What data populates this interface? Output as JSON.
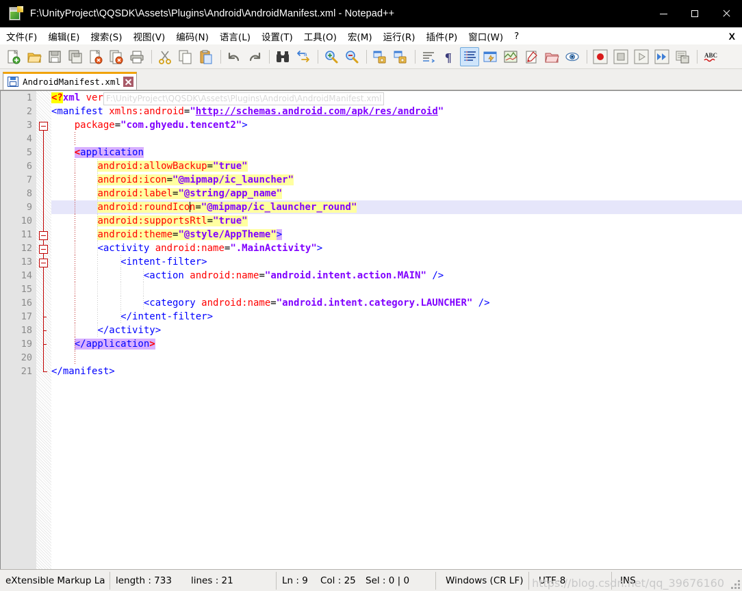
{
  "window": {
    "title": "F:\\UnityProject\\QQSDK\\Assets\\Plugins\\Android\\AndroidManifest.xml - Notepad++",
    "app_icon": "notepad-plus-plus-icon",
    "controls": {
      "minimize": "minimize-icon",
      "maximize": "maximize-icon",
      "close": "close-icon"
    }
  },
  "menubar": {
    "items": [
      {
        "label": "文件(F)",
        "name": "file"
      },
      {
        "label": "编辑(E)",
        "name": "edit"
      },
      {
        "label": "搜索(S)",
        "name": "search"
      },
      {
        "label": "视图(V)",
        "name": "view"
      },
      {
        "label": "编码(N)",
        "name": "encoding"
      },
      {
        "label": "语言(L)",
        "name": "language"
      },
      {
        "label": "设置(T)",
        "name": "settings"
      },
      {
        "label": "工具(O)",
        "name": "tools"
      },
      {
        "label": "宏(M)",
        "name": "macro"
      },
      {
        "label": "运行(R)",
        "name": "run"
      },
      {
        "label": "插件(P)",
        "name": "plugins"
      },
      {
        "label": "窗口(W)",
        "name": "window"
      },
      {
        "label": "?",
        "name": "help"
      }
    ],
    "close_doc_label": "X"
  },
  "toolbar": {
    "groups": [
      [
        {
          "icon": "new-file-icon",
          "label": "新建"
        },
        {
          "icon": "open-folder-icon",
          "label": "打开"
        },
        {
          "icon": "save-icon",
          "label": "保存"
        },
        {
          "icon": "save-all-icon",
          "label": "全部保存"
        },
        {
          "icon": "close-file-icon",
          "label": "关闭"
        },
        {
          "icon": "close-all-files-icon",
          "label": "全部关闭"
        },
        {
          "icon": "print-icon",
          "label": "打印"
        }
      ],
      [
        {
          "icon": "cut-scissors-icon",
          "label": "剪切"
        },
        {
          "icon": "copy-icon",
          "label": "复制"
        },
        {
          "icon": "paste-icon",
          "label": "粘贴"
        }
      ],
      [
        {
          "icon": "undo-arrow-icon",
          "label": "撤销"
        },
        {
          "icon": "redo-arrow-icon",
          "label": "恢复"
        }
      ],
      [
        {
          "icon": "find-binoculars-icon",
          "label": "查找"
        },
        {
          "icon": "replace-icon",
          "label": "替换"
        }
      ],
      [
        {
          "icon": "zoom-in-icon",
          "label": "放大"
        },
        {
          "icon": "zoom-out-icon",
          "label": "缩小"
        }
      ],
      [
        {
          "icon": "sync-vertical-scroll-icon",
          "label": "同步垂直滚动"
        },
        {
          "icon": "sync-horizontal-scroll-icon",
          "label": "同步水平滚动"
        }
      ],
      [
        {
          "icon": "word-wrap-icon",
          "label": "自动换行"
        },
        {
          "icon": "show-all-chars-pilcrow-icon",
          "label": "显示所有字符"
        },
        {
          "icon": "indent-guide-icon",
          "label": "显示缩进参考线",
          "active": true
        },
        {
          "icon": "user-defined-language-icon",
          "label": "用户自定义语言"
        },
        {
          "icon": "document-map-icon",
          "label": "文档地图"
        },
        {
          "icon": "function-list-icon",
          "label": "函数列表"
        },
        {
          "icon": "folder-as-workspace-icon",
          "label": "文件夹作为工作区"
        },
        {
          "icon": "monitor-eye-icon",
          "label": "监视"
        }
      ],
      [
        {
          "icon": "record-macro-icon",
          "label": "开始录制宏"
        },
        {
          "icon": "stop-macro-icon",
          "label": "停止录制宏"
        },
        {
          "icon": "play-macro-icon",
          "label": "播放宏"
        },
        {
          "icon": "run-macro-multiple-icon",
          "label": "多次运行宏"
        },
        {
          "icon": "save-macro-icon",
          "label": "保存当前录制的宏"
        }
      ],
      [
        {
          "icon": "spell-check-abc-icon",
          "label": "拼写检查"
        }
      ]
    ]
  },
  "tabs": [
    {
      "label": "AndroidManifest.xml",
      "icon": "saved-file-icon",
      "close": "tab-close-icon",
      "active": true
    }
  ],
  "editor": {
    "ghost_overlay_text": "F:\\UnityProject\\QQSDK\\Assets\\Plugins\\Android\\AndroidManifest.xml",
    "total_lines": 21,
    "current_line": 9,
    "lines": [
      {
        "n": 1,
        "text": "<?xml version=\"1.0\" encoding=\"utf-8\"?>"
      },
      {
        "n": 2,
        "text": "<manifest xmlns:android=\"http://schemas.android.com/apk/res/android\""
      },
      {
        "n": 3,
        "text": "    package=\"com.ghyedu.tencent2\">"
      },
      {
        "n": 4,
        "text": ""
      },
      {
        "n": 5,
        "text": "    <application"
      },
      {
        "n": 6,
        "text": "        android:allowBackup=\"true\""
      },
      {
        "n": 7,
        "text": "        android:icon=\"@mipmap/ic_launcher\""
      },
      {
        "n": 8,
        "text": "        android:label=\"@string/app_name\""
      },
      {
        "n": 9,
        "text": "        android:roundIcon=\"@mipmap/ic_launcher_round\""
      },
      {
        "n": 10,
        "text": "        android:supportsRtl=\"true\""
      },
      {
        "n": 11,
        "text": "        android:theme=\"@style/AppTheme\">"
      },
      {
        "n": 12,
        "text": "        <activity android:name=\".MainActivity\">"
      },
      {
        "n": 13,
        "text": "            <intent-filter>"
      },
      {
        "n": 14,
        "text": "                <action android:name=\"android.intent.action.MAIN\" />"
      },
      {
        "n": 15,
        "text": ""
      },
      {
        "n": 16,
        "text": "                <category android:name=\"android.intent.category.LAUNCHER\" />"
      },
      {
        "n": 17,
        "text": "            </intent-filter>"
      },
      {
        "n": 18,
        "text": "        </activity>"
      },
      {
        "n": 19,
        "text": "    </application>"
      },
      {
        "n": 20,
        "text": ""
      },
      {
        "n": 21,
        "text": "</manifest>"
      }
    ],
    "fold_points": [
      3,
      11,
      12,
      13
    ]
  },
  "statusbar": {
    "language": "eXtensible Markup La",
    "length_label": "length : 733",
    "lines_label": "lines : 21",
    "ln": "Ln : 9",
    "col": "Col : 25",
    "sel": "Sel : 0 | 0",
    "eol": "Windows (CR LF)",
    "encoding": "UTF-8",
    "mode": "INS",
    "watermark": "https://blog.csdn.net/qq_39676160"
  },
  "colors": {
    "tab_accent": "#f0a30a",
    "tag": "#0000ff",
    "attribute": "#ff0000",
    "value": "#8000ff",
    "highlight_yellow": "#ffffa0",
    "tag_match": "#d8b0ff",
    "current_line": "#e6e6fa",
    "fold_red": "#c00000",
    "titlebar_bg": "#000000",
    "toolbar_bg": "#f4f3f1",
    "gutter_bg": "#e4e4e4"
  }
}
